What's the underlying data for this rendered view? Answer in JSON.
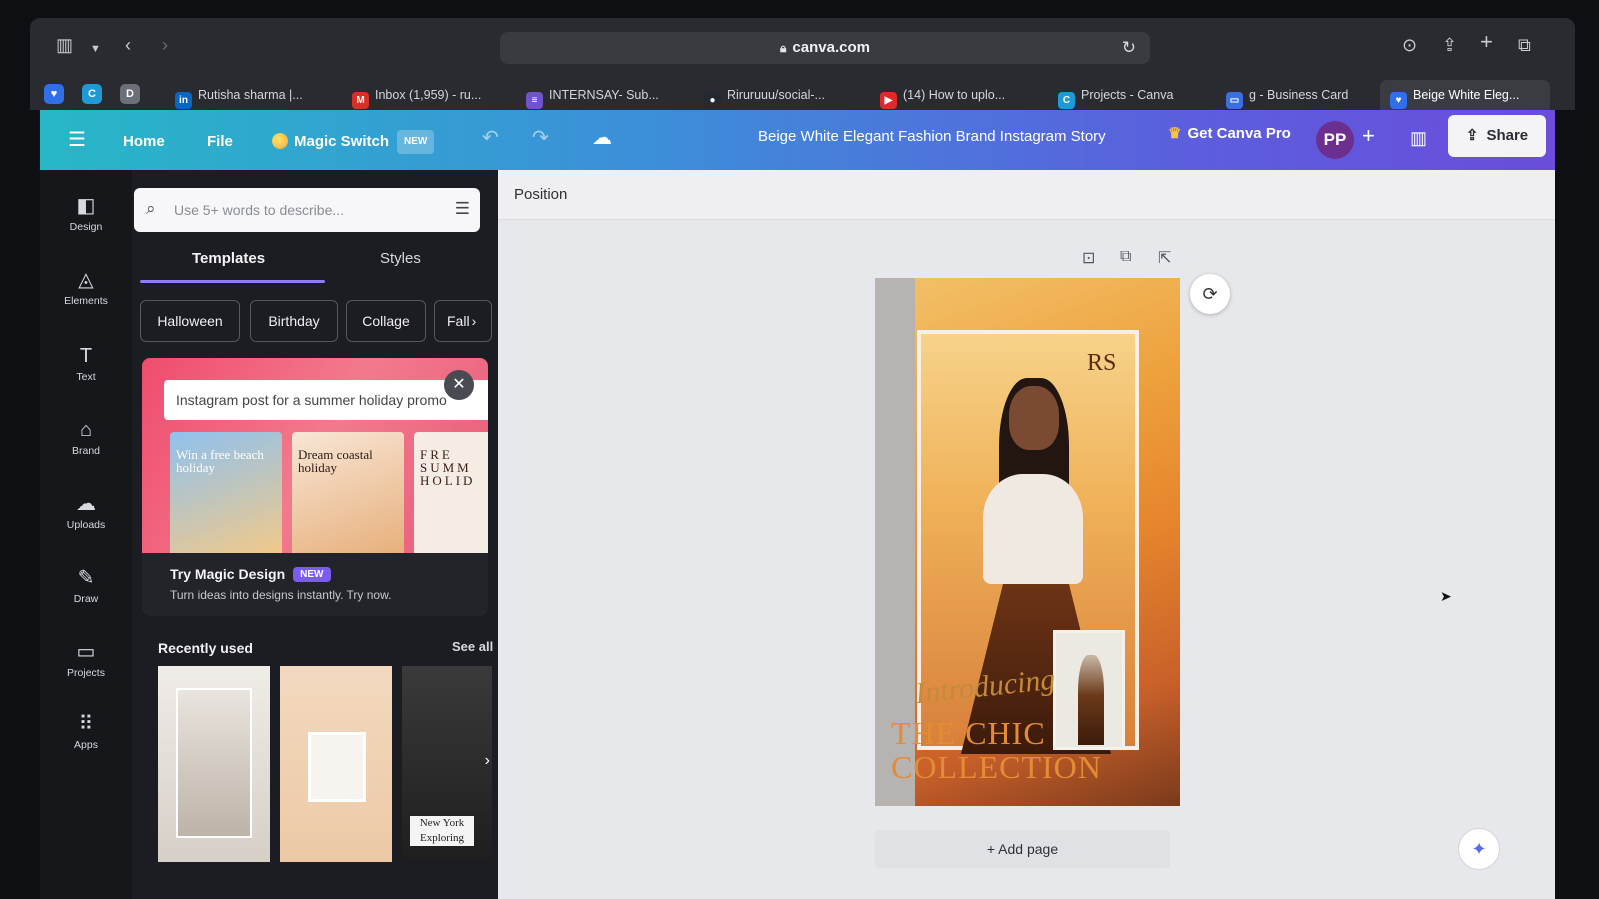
{
  "browser": {
    "url": "canva.com",
    "pinned_tabs": [
      {
        "icon": "heart-shield-icon",
        "letter": "",
        "color": "#2f6fe8"
      },
      {
        "icon": "canva-icon",
        "letter": "C",
        "color": "#1e9ad6"
      },
      {
        "icon": "d-icon",
        "letter": "D",
        "color": "#6b6f7a"
      }
    ],
    "tabs": [
      {
        "title": "Rutisha sharma |...",
        "icon": "linkedin-icon",
        "color": "#0a66c2",
        "letter": "in"
      },
      {
        "title": "Inbox (1,959) - ru...",
        "icon": "gmail-icon",
        "color": "#d93025",
        "letter": "M"
      },
      {
        "title": "INTERNSAY- Sub...",
        "icon": "forms-icon",
        "color": "#6f55c9",
        "letter": "≡"
      },
      {
        "title": "Riruruuu/social-...",
        "icon": "github-icon",
        "color": "#24292f",
        "letter": "●"
      },
      {
        "title": "(14) How to uplo...",
        "icon": "youtube-icon",
        "color": "#e02a2a",
        "letter": "▶"
      },
      {
        "title": "Projects - Canva",
        "icon": "canva-icon",
        "color": "#1e9ad6",
        "letter": "C"
      },
      {
        "title": "g - Business Card",
        "icon": "card-icon",
        "color": "#3a6fe0",
        "letter": "▭"
      },
      {
        "title": "Beige White Eleg...",
        "icon": "heart-shield-icon",
        "color": "#2f6fe8",
        "letter": "♥"
      }
    ]
  },
  "topbar": {
    "home": "Home",
    "file": "File",
    "magic_switch": "Magic Switch",
    "new_badge": "NEW",
    "doc_title": "Beige White Elegant Fashion Brand Instagram Story",
    "get_pro": "Get Canva Pro",
    "avatar": "PP",
    "share": "Share"
  },
  "rail": [
    {
      "label": "Design",
      "icon": "design-icon",
      "glyph": "◧"
    },
    {
      "label": "Elements",
      "icon": "elements-icon",
      "glyph": "◬"
    },
    {
      "label": "Text",
      "icon": "text-icon",
      "glyph": "T"
    },
    {
      "label": "Brand",
      "icon": "brand-icon",
      "glyph": "⌂"
    },
    {
      "label": "Uploads",
      "icon": "uploads-icon",
      "glyph": "☁"
    },
    {
      "label": "Draw",
      "icon": "draw-icon",
      "glyph": "✎"
    },
    {
      "label": "Projects",
      "icon": "projects-icon",
      "glyph": "▭"
    },
    {
      "label": "Apps",
      "icon": "apps-icon",
      "glyph": "⠿"
    }
  ],
  "panel": {
    "search_placeholder": "Use 5+ words to describe...",
    "tabs": [
      "Templates",
      "Styles"
    ],
    "chips": [
      "Halloween",
      "Birthday",
      "Collage",
      "Fall"
    ],
    "promo": {
      "input_text": "Instagram post for a summer holiday promo",
      "thumb1": "Win a free beach holiday",
      "thumb2": "Dream coastal holiday",
      "thumb3": "FRE SUMM HOLID",
      "title": "Try Magic Design",
      "badge": "NEW",
      "subtitle": "Turn ideas into designs instantly. Try now."
    },
    "recent_title": "Recently used",
    "see_all": "See all",
    "recent_caption": [
      "New York",
      "Exploring"
    ]
  },
  "editor": {
    "position": "Position",
    "design_script": "Introducing",
    "design_title": "THE CHIC COLLECTION",
    "design_mark": "RS",
    "add_page": "+ Add page"
  }
}
